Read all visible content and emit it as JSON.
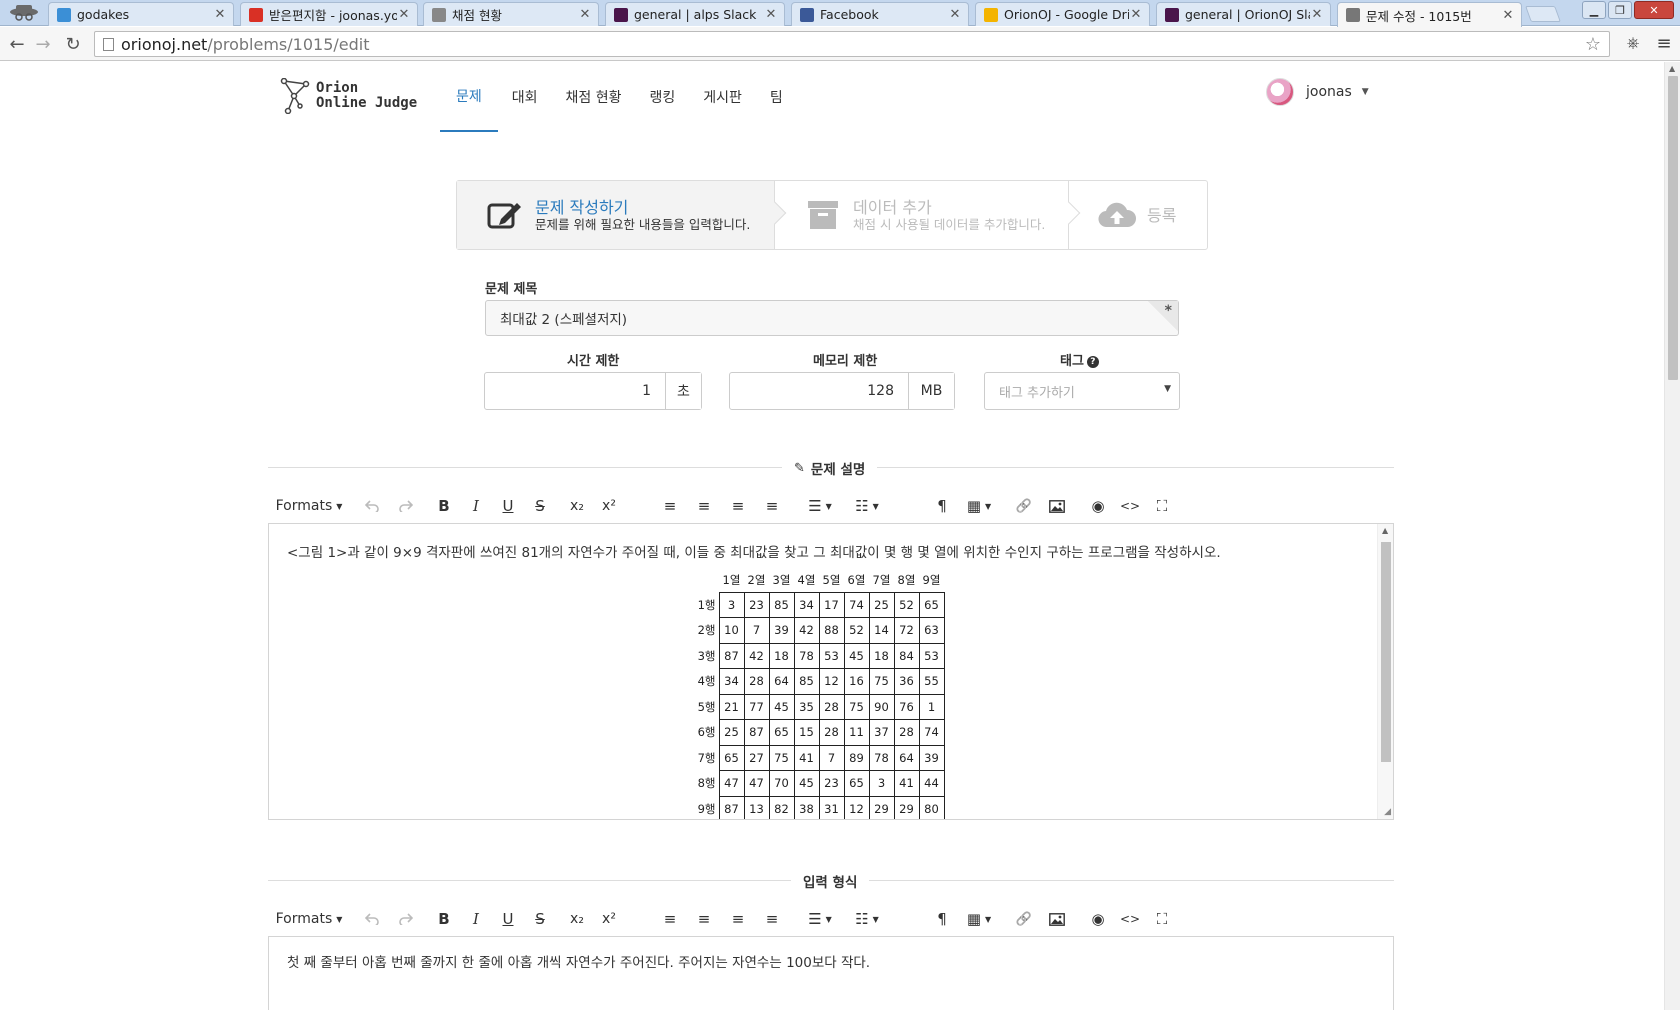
{
  "browser": {
    "tabs": [
      {
        "title": "godakes",
        "favicon": "blue-sq-icon",
        "color": "#3b8fd6"
      },
      {
        "title": "받은편지함 - joonas.yoo",
        "favicon": "gmail-icon",
        "color": "#d93025"
      },
      {
        "title": "채점 현황",
        "favicon": "orion-icon",
        "color": "#888888"
      },
      {
        "title": "general | alps Slack",
        "favicon": "slack-icon",
        "color": "#4a154b"
      },
      {
        "title": "Facebook",
        "favicon": "facebook-icon",
        "color": "#3b5998"
      },
      {
        "title": "OrionOJ - Google Drive",
        "favicon": "drive-icon",
        "color": "#f4b400"
      },
      {
        "title": "general | OrionOJ Slack",
        "favicon": "slack-icon",
        "color": "#4a154b"
      },
      {
        "title": "문제 수정 - 1015번",
        "favicon": "page-icon",
        "color": "#777777"
      }
    ],
    "url_host": "orionoj.net",
    "url_path": "/problems/1015/edit"
  },
  "header": {
    "logo_line1": "Orion",
    "logo_line2": "Online Judge",
    "nav": [
      "문제",
      "대회",
      "채점 현황",
      "랭킹",
      "게시판",
      "팀"
    ],
    "active_nav": "문제",
    "username": "joonas"
  },
  "steps": [
    {
      "title": "문제 작성하기",
      "desc": "문제를 위해 필요한 내용들을 입력합니다."
    },
    {
      "title": "데이터 추가",
      "desc": "채점 시 사용될 데이터를 추가합니다."
    },
    {
      "title": "등록",
      "desc": ""
    }
  ],
  "form": {
    "title_label": "문제 제목",
    "title_value": "최대값 2 (스페셜저지)",
    "required_mark": "*",
    "time_label": "시간 제한",
    "time_value": "1",
    "time_unit": "초",
    "memory_label": "메모리 제한",
    "memory_value": "128",
    "memory_unit": "MB",
    "tag_label": "태그",
    "tag_placeholder": "태그 추가하기"
  },
  "description": {
    "heading": "문제 설명",
    "text": "<그림 1>과 같이 9×9 격자판에 쓰여진 81개의 자연수가 주어질 때, 이들 중 최대값을 찾고 그 최대값이 몇 행 몇 열에 위치한 수인지 구하는 프로그램을 작성하시오.",
    "col_headers": [
      "1열",
      "2열",
      "3열",
      "4열",
      "5열",
      "6열",
      "7열",
      "8열",
      "9열"
    ],
    "row_headers": [
      "1행",
      "2행",
      "3행",
      "4행",
      "5행",
      "6행",
      "7행",
      "8행",
      "9행"
    ],
    "grid": [
      [
        3,
        23,
        85,
        34,
        17,
        74,
        25,
        52,
        65
      ],
      [
        10,
        7,
        39,
        42,
        88,
        52,
        14,
        72,
        63
      ],
      [
        87,
        42,
        18,
        78,
        53,
        45,
        18,
        84,
        53
      ],
      [
        34,
        28,
        64,
        85,
        12,
        16,
        75,
        36,
        55
      ],
      [
        21,
        77,
        45,
        35,
        28,
        75,
        90,
        76,
        1
      ],
      [
        25,
        87,
        65,
        15,
        28,
        11,
        37,
        28,
        74
      ],
      [
        65,
        27,
        75,
        41,
        7,
        89,
        78,
        64,
        39
      ],
      [
        47,
        47,
        70,
        45,
        23,
        65,
        3,
        41,
        44
      ],
      [
        87,
        13,
        82,
        38,
        31,
        12,
        29,
        29,
        80
      ]
    ]
  },
  "input_format": {
    "heading": "입력 형식",
    "text": "첫 째 줄부터 아홉 번째 줄까지 한 줄에 아홉 개씩 자연수가 주어진다. 주어지는 자연수는 100보다 작다."
  },
  "toolbar": {
    "formats_label": "Formats"
  }
}
